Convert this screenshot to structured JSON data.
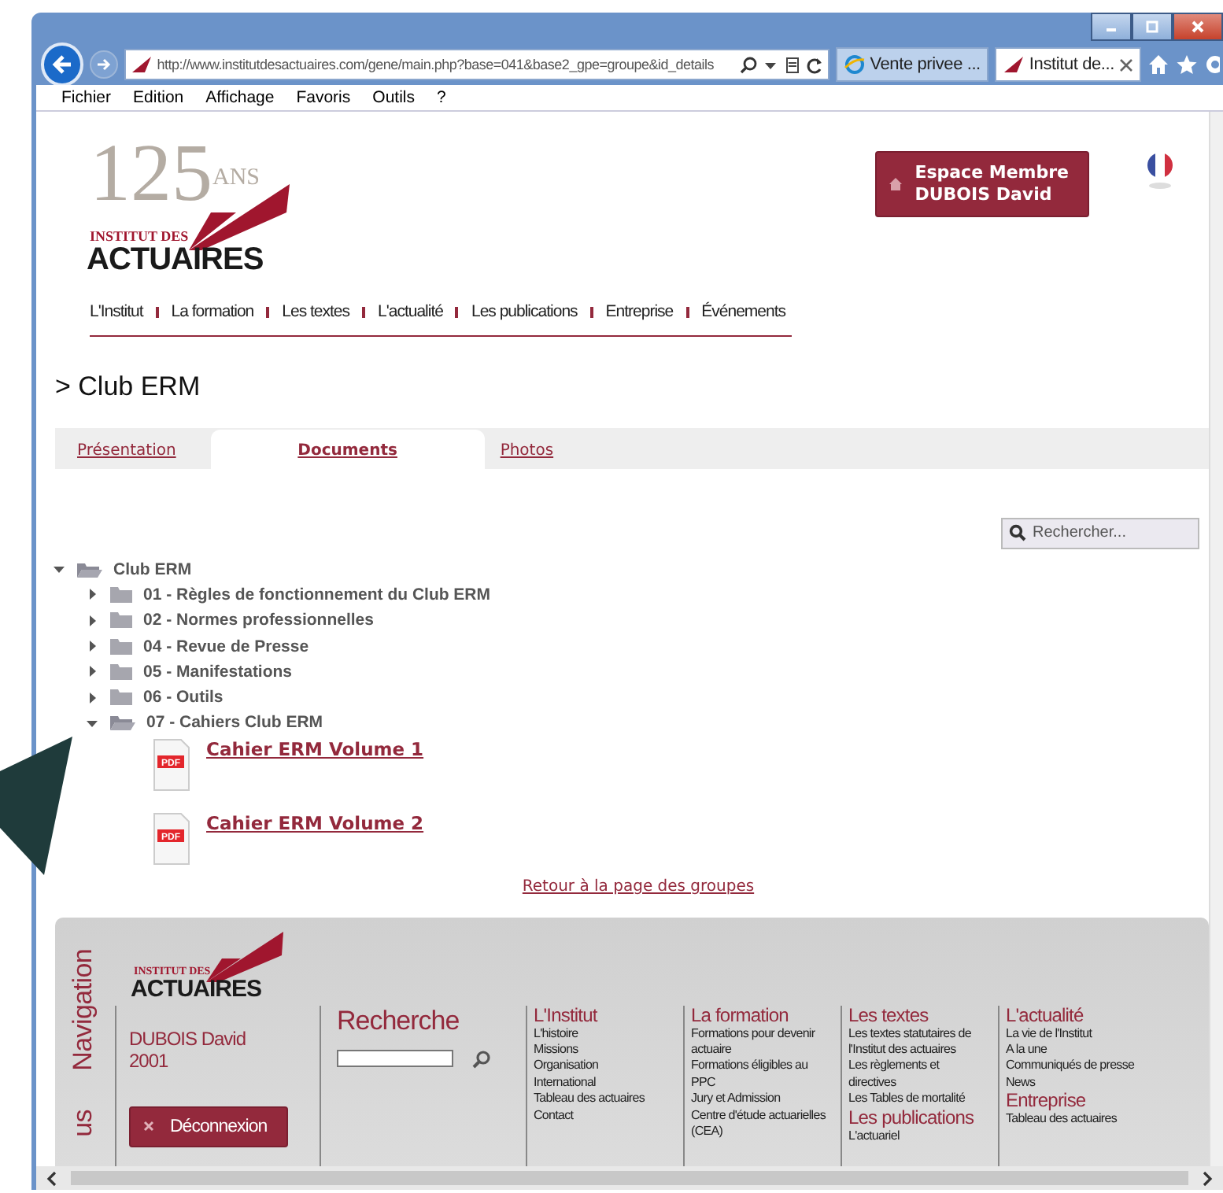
{
  "browser": {
    "address": "http://www.institutdesactuaires.com/gene/main.php?base=041&base2_gpe=groupe&id_details",
    "tabs": [
      {
        "label": "Vente privee ...",
        "selected": false
      },
      {
        "label": "Institut de...",
        "selected": true
      }
    ],
    "menu": [
      "Fichier",
      "Edition",
      "Affichage",
      "Favoris",
      "Outils",
      "?"
    ]
  },
  "header": {
    "logo": {
      "number": "125",
      "ans": "ANS",
      "line1": "INSTITUT DES",
      "line2": "ACTUAIRES"
    },
    "member_button": [
      "Espace Membre",
      "DUBOIS David"
    ],
    "nav": [
      "L'Institut",
      "La formation",
      "Les textes",
      "L'actualité",
      "Les publications",
      "Entreprise",
      "Événements"
    ]
  },
  "page_title": "> Club ERM",
  "tabs": [
    {
      "label": "Présentation",
      "selected": false
    },
    {
      "label": "Documents",
      "selected": true
    },
    {
      "label": "Photos",
      "selected": false
    }
  ],
  "search": {
    "placeholder": "Rechercher..."
  },
  "tree": [
    {
      "kind": "folder",
      "label": "Club ERM",
      "expanded": true,
      "children": [
        {
          "kind": "folder",
          "label": "01 - Règles de fonctionnement du Club ERM",
          "expanded": false
        },
        {
          "kind": "folder",
          "label": "02 - Normes professionnelles",
          "expanded": false
        },
        {
          "kind": "folder",
          "label": "04 - Revue de Presse",
          "expanded": false
        },
        {
          "kind": "folder",
          "label": "05 - Manifestations",
          "expanded": false
        },
        {
          "kind": "folder",
          "label": "06 - Outils",
          "expanded": false
        },
        {
          "kind": "folder",
          "label": "07 - Cahiers Club ERM",
          "expanded": true,
          "children": [
            {
              "kind": "pdf",
              "label": "Cahier ERM Volume 1",
              "badge": "PDF"
            },
            {
              "kind": "pdf",
              "label": "Cahier ERM Volume 2",
              "badge": "PDF"
            }
          ]
        }
      ]
    }
  ],
  "back_link": "Retour à la page des groupes",
  "footer": {
    "side_labels": [
      "Navigation",
      "us"
    ],
    "logo": {
      "line1": "INSTITUT DES",
      "line2": "ACTUAIRES"
    },
    "user": {
      "name": "DUBOIS David",
      "year": "2001",
      "logout": "Déconnexion"
    },
    "search_title": "Recherche",
    "columns": [
      [
        {
          "heading": "L'Institut",
          "links": [
            "L'histoire",
            "Missions",
            "Organisation",
            "International",
            "Tableau des actuaires",
            "Contact"
          ]
        }
      ],
      [
        {
          "heading": "La formation",
          "links": [
            "Formations pour devenir actuaire",
            "Formations éligibles au PPC",
            "Jury et Admission",
            "Centre d'étude actuarielles (CEA)"
          ]
        }
      ],
      [
        {
          "heading": "Les textes",
          "links": [
            "Les textes statutaires de l'Institut des actuaires",
            "Les règlements et directives",
            "Les Tables de mortalité"
          ]
        },
        {
          "heading": "Les publications",
          "links": [
            "L'actuariel"
          ]
        }
      ],
      [
        {
          "heading": "L'actualité",
          "links": [
            "La vie de l'Institut",
            "A la une",
            "Communiqués de presse",
            "News"
          ]
        },
        {
          "heading": "Entreprise",
          "links": [
            "Tableau des actuaires"
          ]
        }
      ]
    ]
  }
}
